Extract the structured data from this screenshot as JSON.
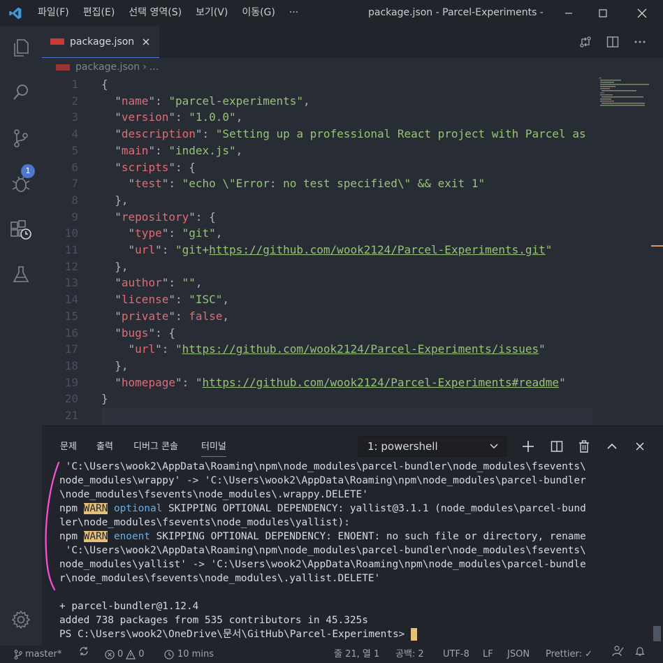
{
  "titlebar": {
    "menu": [
      "파일(F)",
      "편집(E)",
      "선택 영역(S)",
      "보기(V)",
      "이동(G)",
      "···"
    ],
    "window_title": "package.json - Parcel-Experiments -..."
  },
  "activity": {
    "source_control_badge": "1"
  },
  "tabs": {
    "active_label": "package.json",
    "close_glyph": "×"
  },
  "breadcrumb": {
    "file": "package.json",
    "separator": "›",
    "ellipsis": "..."
  },
  "editor": {
    "line_numbers": [
      "1",
      "2",
      "3",
      "4",
      "5",
      "6",
      "7",
      "8",
      "9",
      "10",
      "11",
      "12",
      "13",
      "14",
      "15",
      "16",
      "17",
      "18",
      "19",
      "20",
      "21"
    ],
    "lines": [
      [
        {
          "t": "{",
          "c": "p"
        }
      ],
      [
        {
          "t": "  \"",
          "c": "p"
        },
        {
          "t": "name",
          "c": "k"
        },
        {
          "t": "\": ",
          "c": "p"
        },
        {
          "t": "\"parcel-experiments\"",
          "c": "s"
        },
        {
          "t": ",",
          "c": "p"
        }
      ],
      [
        {
          "t": "  \"",
          "c": "p"
        },
        {
          "t": "version",
          "c": "k"
        },
        {
          "t": "\": ",
          "c": "p"
        },
        {
          "t": "\"1.0.0\"",
          "c": "s"
        },
        {
          "t": ",",
          "c": "p"
        }
      ],
      [
        {
          "t": "  \"",
          "c": "p"
        },
        {
          "t": "description",
          "c": "k"
        },
        {
          "t": "\": ",
          "c": "p"
        },
        {
          "t": "\"Setting up a professional React project with Parcel as",
          "c": "s"
        }
      ],
      [
        {
          "t": "  \"",
          "c": "p"
        },
        {
          "t": "main",
          "c": "k"
        },
        {
          "t": "\": ",
          "c": "p"
        },
        {
          "t": "\"index.js\"",
          "c": "s"
        },
        {
          "t": ",",
          "c": "p"
        }
      ],
      [
        {
          "t": "  \"",
          "c": "p"
        },
        {
          "t": "scripts",
          "c": "k"
        },
        {
          "t": "\": {",
          "c": "p"
        }
      ],
      [
        {
          "t": "    \"",
          "c": "p"
        },
        {
          "t": "test",
          "c": "k"
        },
        {
          "t": "\": ",
          "c": "p"
        },
        {
          "t": "\"echo \\\"Error: no test specified\\\" && exit 1\"",
          "c": "s"
        }
      ],
      [
        {
          "t": "  },",
          "c": "p"
        }
      ],
      [
        {
          "t": "  \"",
          "c": "p"
        },
        {
          "t": "repository",
          "c": "k"
        },
        {
          "t": "\": {",
          "c": "p"
        }
      ],
      [
        {
          "t": "    \"",
          "c": "p"
        },
        {
          "t": "type",
          "c": "k"
        },
        {
          "t": "\": ",
          "c": "p"
        },
        {
          "t": "\"git\"",
          "c": "s"
        },
        {
          "t": ",",
          "c": "p"
        }
      ],
      [
        {
          "t": "    \"",
          "c": "p"
        },
        {
          "t": "url",
          "c": "k"
        },
        {
          "t": "\": ",
          "c": "p"
        },
        {
          "t": "\"git+",
          "c": "s"
        },
        {
          "t": "https://github.com/wook2124/Parcel-Experiments.git",
          "c": "u"
        },
        {
          "t": "\"",
          "c": "s"
        }
      ],
      [
        {
          "t": "  },",
          "c": "p"
        }
      ],
      [
        {
          "t": "  \"",
          "c": "p"
        },
        {
          "t": "author",
          "c": "k"
        },
        {
          "t": "\": ",
          "c": "p"
        },
        {
          "t": "\"\"",
          "c": "s"
        },
        {
          "t": ",",
          "c": "p"
        }
      ],
      [
        {
          "t": "  \"",
          "c": "p"
        },
        {
          "t": "license",
          "c": "k"
        },
        {
          "t": "\": ",
          "c": "p"
        },
        {
          "t": "\"ISC\"",
          "c": "s"
        },
        {
          "t": ",",
          "c": "p"
        }
      ],
      [
        {
          "t": "  \"",
          "c": "p"
        },
        {
          "t": "private",
          "c": "k"
        },
        {
          "t": "\": ",
          "c": "p"
        },
        {
          "t": "false",
          "c": "k"
        },
        {
          "t": ",",
          "c": "p"
        }
      ],
      [
        {
          "t": "  \"",
          "c": "p"
        },
        {
          "t": "bugs",
          "c": "k"
        },
        {
          "t": "\": {",
          "c": "p"
        }
      ],
      [
        {
          "t": "    \"",
          "c": "p"
        },
        {
          "t": "url",
          "c": "k"
        },
        {
          "t": "\": ",
          "c": "p"
        },
        {
          "t": "\"",
          "c": "s"
        },
        {
          "t": "https://github.com/wook2124/Parcel-Experiments/issues",
          "c": "u"
        },
        {
          "t": "\"",
          "c": "s"
        }
      ],
      [
        {
          "t": "  },",
          "c": "p"
        }
      ],
      [
        {
          "t": "  \"",
          "c": "p"
        },
        {
          "t": "homepage",
          "c": "k"
        },
        {
          "t": "\": ",
          "c": "p"
        },
        {
          "t": "\"",
          "c": "s"
        },
        {
          "t": "https://github.com/wook2124/Parcel-Experiments#readme",
          "c": "u"
        },
        {
          "t": "\"",
          "c": "s"
        }
      ],
      [
        {
          "t": "}",
          "c": "p"
        }
      ],
      []
    ]
  },
  "panel": {
    "tabs": [
      "문제",
      "출력",
      "디버그 콘솔",
      "터미널"
    ],
    "terminal_select": "1: powershell",
    "terminal_lines": [
      [
        {
          "t": " 'C:\\Users\\wook2\\AppData\\Roaming\\npm\\node_modules\\parcel-bundler\\node_modules\\fsevents\\"
        }
      ],
      [
        {
          "t": "node_modules\\wrappy' -> 'C:\\Users\\wook2\\AppData\\Roaming\\npm\\node_modules\\parcel-bundler"
        }
      ],
      [
        {
          "t": "\\node_modules\\fsevents\\node_modules\\.wrappy.DELETE'"
        }
      ],
      [
        {
          "t": "npm "
        },
        {
          "t": "WARN",
          "c": "warn"
        },
        {
          "t": " "
        },
        {
          "t": "optional",
          "c": "opt"
        },
        {
          "t": " SKIPPING OPTIONAL DEPENDENCY: yallist@3.1.1 (node_modules\\parcel-bund"
        }
      ],
      [
        {
          "t": "ler\\node_modules\\fsevents\\node_modules\\yallist):"
        }
      ],
      [
        {
          "t": "npm "
        },
        {
          "t": "WARN",
          "c": "warn"
        },
        {
          "t": " "
        },
        {
          "t": "enoent",
          "c": "opt"
        },
        {
          "t": " SKIPPING OPTIONAL DEPENDENCY: ENOENT: no such file or directory, rename"
        }
      ],
      [
        {
          "t": " 'C:\\Users\\wook2\\AppData\\Roaming\\npm\\node_modules\\parcel-bundler\\node_modules\\fsevents\\"
        }
      ],
      [
        {
          "t": "node_modules\\yallist' -> 'C:\\Users\\wook2\\AppData\\Roaming\\npm\\node_modules\\parcel-bundle"
        }
      ],
      [
        {
          "t": "r\\node_modules\\fsevents\\node_modules\\.yallist.DELETE'"
        }
      ],
      [],
      [
        {
          "t": "+ parcel-bundler@1.12.4"
        }
      ],
      [
        {
          "t": "added 738 packages from 535 contributors in 45.325s"
        }
      ],
      [
        {
          "t": "PS C:\\Users\\wook2\\OneDrive\\문서\\GitHub\\Parcel-Experiments> "
        }
      ]
    ]
  },
  "statusbar": {
    "branch": "master*",
    "errors": "0",
    "warnings": "0",
    "time": "10 mins",
    "position": "줄 21, 열 1",
    "spaces": "공백: 2",
    "encoding": "UTF-8",
    "eol": "LF",
    "language": "JSON",
    "formatter": "Prettier: ✓"
  },
  "colors": {
    "accent": "#4d78cc",
    "warn": "#e5c07b",
    "string": "#98c379",
    "key": "#e06c75"
  }
}
